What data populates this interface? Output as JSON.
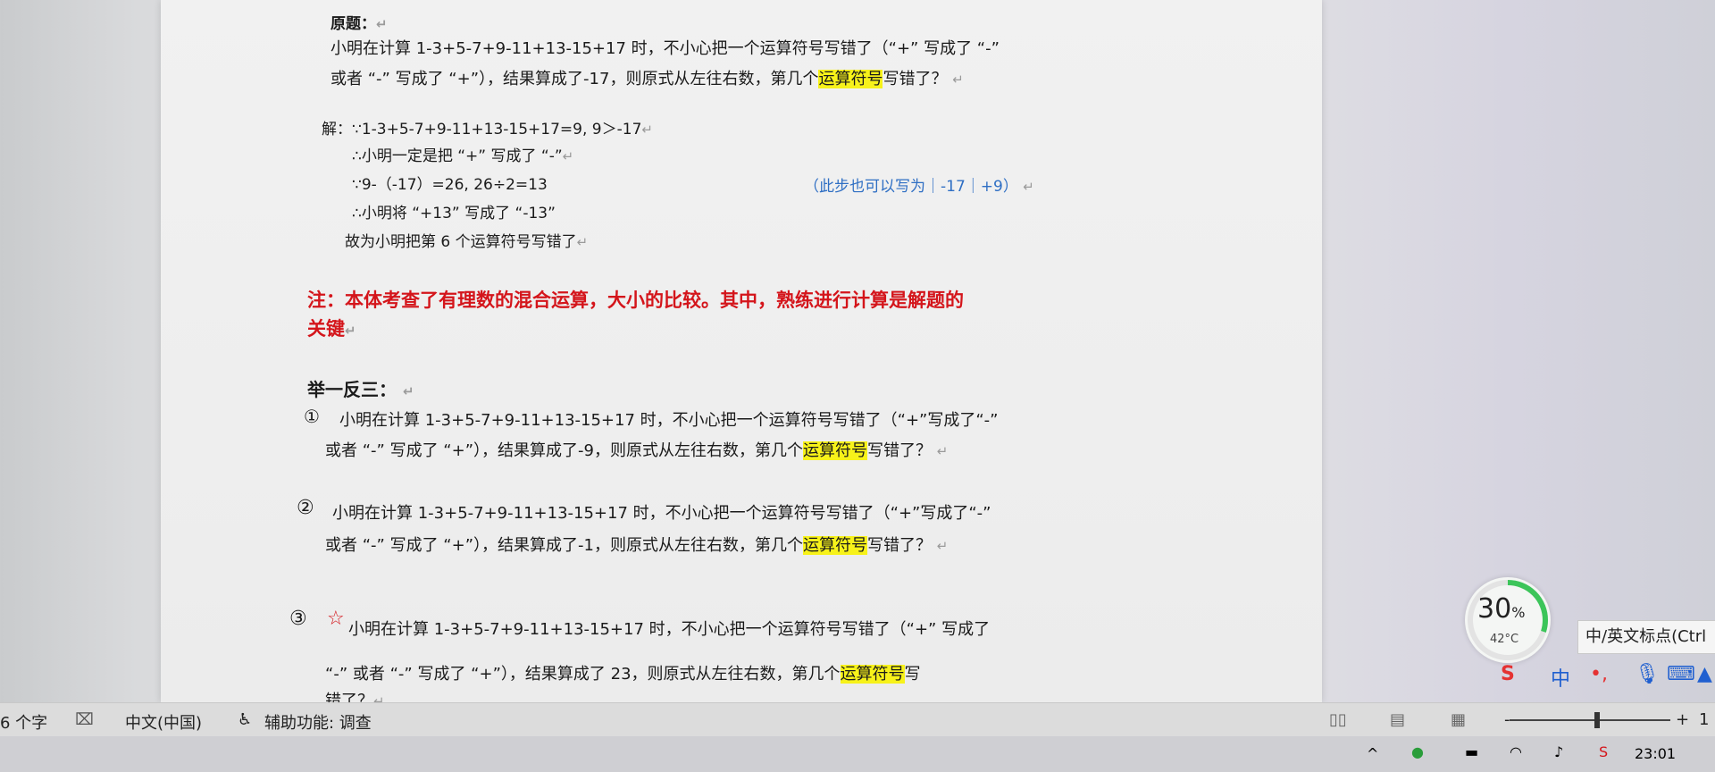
{
  "document": {
    "original_label": "原题：",
    "original_line1": "小明在计算 1-3+5-7+9-11+13-15+17 时，不小心把一个运算符号写错了（“+” 写成了 “-”",
    "original_line2_pre": "或者 “-” 写成了 “+”），结果算成了-17，则原式从左往右数，第几个",
    "original_line2_hl": "运算符号",
    "original_line2_post": "写错了？",
    "solution_label": "解：",
    "sol1": "∵1-3+5-7+9-11+13-15+17=9, 9＞-17",
    "sol2": "∴小明一定是把 “+” 写成了 “-”",
    "sol3": "∵9-（-17）=26, 26÷2=13",
    "sol3_note": "（此步也可以写为｜-17｜+9）",
    "sol4": "∴小明将 “+13” 写成了 “-13”",
    "sol5": "故为小明把第 6 个运算符号写错了",
    "note_line1": "注：本体考查了有理数的混合运算，大小的比较。其中，熟练进行计算是解题的",
    "note_line2": "关键",
    "extension_title": "举一反三：",
    "q1_num": "①",
    "q1_line1": "小明在计算 1-3+5-7+9-11+13-15+17 时，不小心把一个运算符号写错了（“+”写成了“-”",
    "q1_line2_pre": "或者 “-” 写成了 “+”），结果算成了-9，则原式从左往右数，第几个",
    "q1_line2_hl": "运算符号",
    "q1_line2_post": "写错了？",
    "q2_num": "②",
    "q2_line1": "小明在计算 1-3+5-7+9-11+13-15+17 时，不小心把一个运算符号写错了（“+”写成了“-”",
    "q2_line2_pre": "或者 “-” 写成了 “+”），结果算成了-1，则原式从左往右数，第几个",
    "q2_line2_hl": "运算符号",
    "q2_line2_post": "写错了？",
    "q3_num": "③",
    "q3_star": "☆",
    "q3_line1": "小明在计算 1-3+5-7+9-11+13-15+17 时，不小心把一个运算符号写错了（“+” 写成了",
    "q3_line2_pre": "“-” 或者 “-” 写成了 “+”），结果算成了 23，则原式从左往右数，第几个",
    "q3_line2_hl": "运算符号",
    "q3_line2_post": "写",
    "q3_line3": "错了？",
    "para_mark": "↵"
  },
  "statusbar": {
    "word_count": "6 个字",
    "language": "中文(中国)",
    "accessibility": "辅助功能: 调查",
    "zoom_minus": "-",
    "zoom_plus": "+",
    "zoom_value": "1"
  },
  "widget": {
    "percent": "30",
    "percent_unit": "%",
    "temperature": "42°C"
  },
  "tooltip": {
    "text": "中/英文标点(Ctrl"
  },
  "ime": {
    "lang": "中",
    "punct": "•,"
  },
  "taskbar": {
    "time": "23:01"
  },
  "colors": {
    "highlight": "#f7f21a",
    "note_red": "#d4151b",
    "blue": "#2f6fc4",
    "widget_green": "#3cc55a"
  }
}
